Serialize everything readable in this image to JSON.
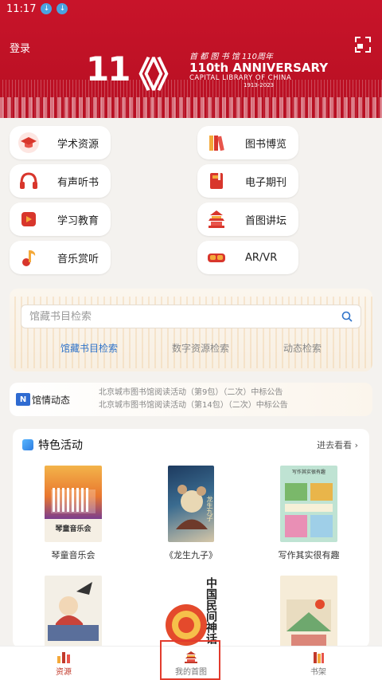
{
  "status": {
    "time": "11:17"
  },
  "banner": {
    "login": "登录",
    "logo_number": "11",
    "logo_chevrons": "《》",
    "brand_cn": "首 都 图 书 馆 110周年",
    "brand_anniversary": "110th ANNIVERSARY",
    "brand_library": "CAPITAL LIBRARY OF CHINA",
    "brand_years": "1913-2023"
  },
  "categories": [
    {
      "label": "学术资源",
      "icon": "graduation-cap-icon",
      "color": "#d8362c"
    },
    {
      "label": "图书博览",
      "icon": "books-icon",
      "color": "#d8362c"
    },
    {
      "label": "有声听书",
      "icon": "headphones-icon",
      "color": "#d8362c"
    },
    {
      "label": "电子期刊",
      "icon": "journal-icon",
      "color": "#d8362c"
    },
    {
      "label": "学习教育",
      "icon": "video-icon",
      "color": "#d8362c"
    },
    {
      "label": "首图讲坛",
      "icon": "temple-icon",
      "color": "#d8362c"
    },
    {
      "label": "音乐赏听",
      "icon": "music-note-icon",
      "color": "#d8362c"
    },
    {
      "label": "AR/VR",
      "icon": "vr-headset-icon",
      "color": "#d8362c"
    }
  ],
  "search": {
    "placeholder": "馆藏书目检索",
    "tabs": [
      "馆藏书目检索",
      "数字资源检索",
      "动态检索"
    ],
    "active_tab": 0
  },
  "news": {
    "title": "馆情动态",
    "items": [
      "北京城市图书馆阅读活动（第9包）（二次）中标公告",
      "北京城市图书馆阅读活动（第14包）（二次）中标公告"
    ]
  },
  "features": {
    "title": "特色活动",
    "more": "进去看看",
    "items": [
      {
        "title": "琴童音乐会",
        "cover_text": "琴童音乐会"
      },
      {
        "title": "《龙生九子》",
        "cover_text": "龙生九子"
      },
      {
        "title": "写作其实很有趣",
        "cover_text": "写作其实很有趣"
      },
      {
        "title": "",
        "cover_text": ""
      },
      {
        "title": "",
        "cover_text": "中国民间神话"
      },
      {
        "title": "",
        "cover_text": ""
      }
    ]
  },
  "bottom_nav": [
    {
      "label": "资源",
      "icon": "bar-chart-icon"
    },
    {
      "label": "我的首图",
      "icon": "temple-icon"
    },
    {
      "label": "书架",
      "icon": "bookshelf-icon"
    }
  ],
  "accent": "#c8142a"
}
